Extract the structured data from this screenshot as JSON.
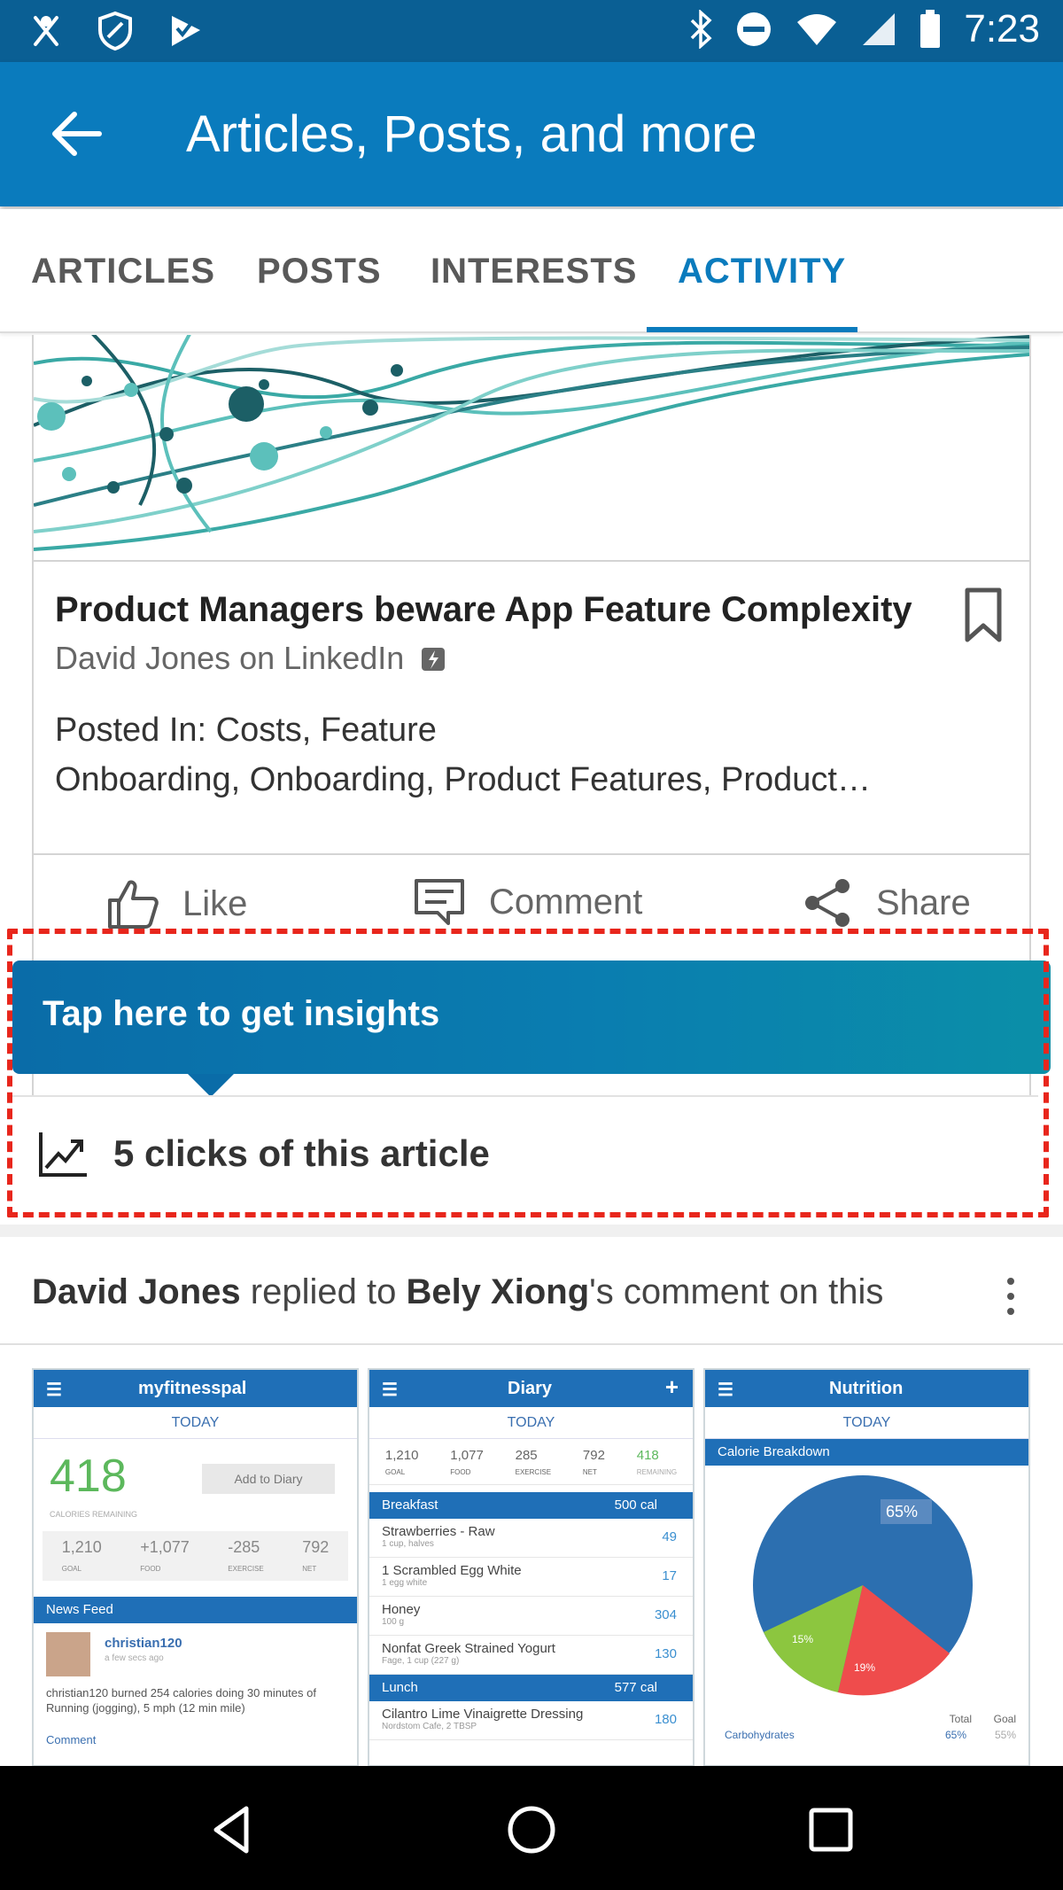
{
  "status_bar": {
    "time": "7:23"
  },
  "app_bar": {
    "title": "Articles, Posts, and more"
  },
  "tabs": [
    {
      "label": "ARTICLES"
    },
    {
      "label": "POSTS"
    },
    {
      "label": "INTERESTS"
    },
    {
      "label": "ACTIVITY",
      "active": true
    }
  ],
  "article": {
    "title": "Product Managers beware App Feature Complexity",
    "source": "David Jones on LinkedIn",
    "posted_line1": "Posted In: Costs, Feature",
    "posted_line2": "Onboarding, Onboarding, Product Features, Product…"
  },
  "actions": {
    "like": "Like",
    "comment": "Comment",
    "share": "Share"
  },
  "insights": {
    "banner_text": "Tap here to get insights",
    "clicks_text": "5 clicks of this article"
  },
  "feed_item": {
    "actor": "David Jones",
    "verb": " replied to ",
    "target": "Bely Xiong",
    "suffix": "'s comment on this"
  },
  "screens": {
    "s1": {
      "title": "myfitnesspal",
      "today": "TODAY",
      "remaining": "418",
      "remaining_label": "CALORIES REMAINING",
      "add_button": "Add to Diary",
      "stats": [
        "1,210",
        "+1,077",
        "-285",
        "792"
      ],
      "stat_labels": [
        "GOAL",
        "FOOD",
        "EXERCISE",
        "NET"
      ],
      "news_feed": "News Feed",
      "user": "christian120",
      "user_time": "a few secs ago",
      "post": "christian120 burned 254 calories doing 30 minutes of Running (jogging), 5 mph (12 min mile)",
      "comment": "Comment"
    },
    "s2": {
      "title": "Diary",
      "today": "TODAY",
      "stats": [
        "1,210",
        "1,077",
        "285",
        "792",
        "418"
      ],
      "stat_labels": [
        "GOAL",
        "FOOD",
        "EXERCISE",
        "NET",
        "REMAINING"
      ],
      "breakfast": "Breakfast",
      "breakfast_cal": "500 cal",
      "items": [
        {
          "name": "Strawberries - Raw",
          "detail": "1 cup, halves",
          "value": "49"
        },
        {
          "name": "1 Scrambled Egg White",
          "detail": "1 egg white",
          "value": "17"
        },
        {
          "name": "Honey",
          "detail": "100 g",
          "value": "304"
        },
        {
          "name": "Nonfat Greek Strained Yogurt",
          "detail": "Fage, 1 cup (227 g)",
          "value": "130"
        }
      ],
      "lunch": "Lunch",
      "lunch_cal": "577 cal",
      "lunch_item": {
        "name": "Cilantro Lime Vinaigrette Dressing",
        "detail": "Nordstom Cafe, 2 TBSP",
        "value": "180"
      }
    },
    "s3": {
      "title": "Nutrition",
      "today": "TODAY",
      "breakdown": "Calorie Breakdown",
      "pct_big": "65%",
      "pct_green": "15%",
      "pct_red": "19%",
      "total": "Total",
      "goal": "Goal",
      "carbs": "Carbohydrates",
      "carbs_total": "65%",
      "carbs_goal": "55%"
    }
  },
  "colors": {
    "status_bar": "#0a5f94",
    "app_bar": "#0a7bbd",
    "accent": "#0a7bbd",
    "highlight_border": "#e8261c",
    "insight_banner": "#0a6ca8"
  },
  "icons": [
    "back-arrow-icon",
    "bookmark-icon",
    "like-icon",
    "comment-icon",
    "share-icon",
    "trend-chart-icon",
    "more-vert-icon",
    "nav-back-icon",
    "nav-home-icon",
    "nav-recents-icon"
  ]
}
